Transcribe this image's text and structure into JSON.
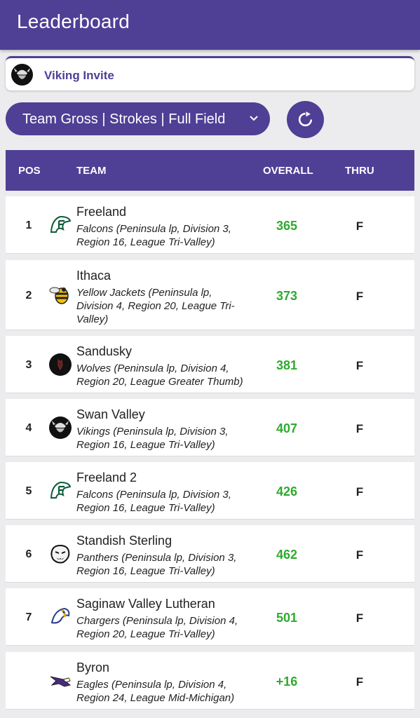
{
  "appbar": {
    "title": "Leaderboard"
  },
  "event": {
    "name": "Viking Invite"
  },
  "filter": {
    "label": "Team Gross | Strokes | Full Field"
  },
  "table": {
    "headers": {
      "pos": "POS",
      "team": "TEAM",
      "overall": "OVERALL",
      "thru": "THRU"
    },
    "rows": [
      {
        "pos": "1",
        "team": "Freeland",
        "desc": "Falcons (Peninsula lp, Division 3, Region 16, League Tri-Valley)",
        "score": "365",
        "thru": "F",
        "logo": "falcon-logo-icon"
      },
      {
        "pos": "2",
        "team": "Ithaca",
        "desc": "Yellow Jackets (Peninsula lp, Division 4, Region 20, League Tri-Valley)",
        "score": "373",
        "thru": "F",
        "logo": "yellow-jacket-logo-icon"
      },
      {
        "pos": "3",
        "team": "Sandusky",
        "desc": "Wolves (Peninsula lp, Division 4, Region 20, League Greater Thumb)",
        "score": "381",
        "thru": "F",
        "logo": "wolf-logo-icon"
      },
      {
        "pos": "4",
        "team": "Swan Valley",
        "desc": "Vikings (Peninsula lp, Division 3, Region 16, League Tri-Valley)",
        "score": "407",
        "thru": "F",
        "logo": "viking-logo-icon"
      },
      {
        "pos": "5",
        "team": "Freeland 2",
        "desc": "Falcons (Peninsula lp, Division 3, Region 16, League Tri-Valley)",
        "score": "426",
        "thru": "F",
        "logo": "falcon-logo-icon"
      },
      {
        "pos": "6",
        "team": "Standish Sterling",
        "desc": "Panthers (Peninsula lp, Division 3, Region 16, League Tri-Valley)",
        "score": "462",
        "thru": "F",
        "logo": "panther-logo-icon"
      },
      {
        "pos": "7",
        "team": "Saginaw Valley Lutheran",
        "desc": "Chargers (Peninsula lp, Division 4, Region 20, League Tri-Valley)",
        "score": "501",
        "thru": "F",
        "logo": "charger-logo-icon"
      },
      {
        "pos": "",
        "team": "Byron",
        "desc": "Eagles (Peninsula lp, Division 4, Region 24, League Mid-Michigan)",
        "score": "+16",
        "thru": "F",
        "logo": "eagle-logo-icon"
      }
    ]
  },
  "colors": {
    "primary": "#4f3f95",
    "score": "#2eaa2e",
    "background": "#ececee"
  }
}
